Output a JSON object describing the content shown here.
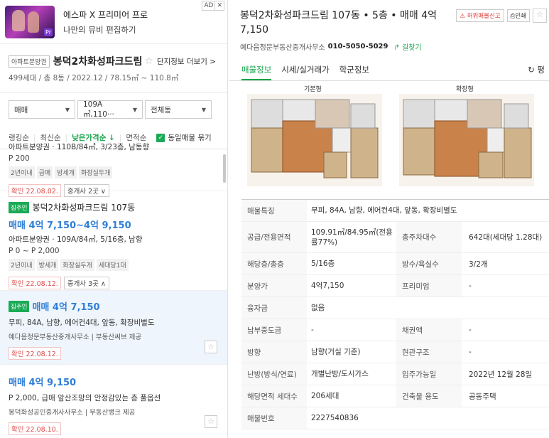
{
  "ad": {
    "title": "에스파 X 프리미어 프로",
    "subtitle": "나만의 뮤비 편집하기",
    "badge": "AD",
    "close": "✕",
    "thumb_badge": "Pr"
  },
  "complex": {
    "tag": "아파트분양권",
    "name": "봉덕2차화성파크드림",
    "more": "단지정보 더보기 >",
    "meta": "499세대 / 총 8동 / 2022.12 / 78.15㎡ ~ 110.8㎡"
  },
  "filters": {
    "trade": "매매",
    "area": "109A㎡,110···",
    "dong": "전체동"
  },
  "sort": {
    "ranking": "랭킹순",
    "latest": "최신순",
    "low_price": "낮은가격순 ↓",
    "area": "면적순",
    "group_label": "동일매물 묶기"
  },
  "listings": [
    {
      "desc": "아파트분양권 · 110B/84㎡, 3/23층, 남동향",
      "desc2": "P 200",
      "tags": [
        "2년이내",
        "급매",
        "방세개",
        "화장실두개"
      ],
      "confirmed": "확인 22.08.02.",
      "brokers": "중개사 2곳 ∨"
    },
    {
      "badge": "집주인",
      "title": "봉덕2차화성파크드림 107동",
      "price": "매매 4억 7,150~4억 9,150",
      "desc": "아파트분양권 · 109A/84㎡, 5/16층, 남향",
      "desc2": "P 0 ~ P 2,000",
      "tags": [
        "2년이내",
        "방세개",
        "화장실두개",
        "세대당1대"
      ],
      "confirmed": "확인 22.08.12.",
      "brokers": "중개사 3곳 ∧"
    },
    {
      "badge": "집주인",
      "price": "매매 4억 7,150",
      "desc": "무피, 84A, 남향, 에어컨4대, 앞동, 확장비별도",
      "agent": "예다음정문부동산중개사무소 | 부동산써브 제공",
      "confirmed": "확인 22.08.12."
    },
    {
      "price": "매매 4억 9,150",
      "desc": "P 2,000, 급매 앞산조망의 안정감있는 층 풀옵션",
      "agent": "봉덕화성공인중개사사무소 | 부동산뱅크 제공",
      "confirmed": "확인 22.08.10."
    }
  ],
  "detail": {
    "title": "봉덕2차화성파크드림 107동 • 5층 • 매매 4억 7,150",
    "report": "허위매물신고",
    "print": "인쇄",
    "agent": "예다음정문부동산중개사무소",
    "tel": "010-5050-5029",
    "directions": "길찾기",
    "tabs": [
      "매물정보",
      "시세/실거래가",
      "학군정보"
    ],
    "refresh": "평",
    "plan_labels": [
      "기본형",
      "확장형"
    ],
    "rows": [
      {
        "k": "매물특징",
        "v": "무피, 84A, 남향, 에어컨4대, 앞동, 확장비별도"
      },
      {
        "k": "공급/전용면적",
        "v": "109.91㎡/84.95㎡(전용률77%)",
        "k2": "총주차대수",
        "v2": "642대(세대당 1.28대)"
      },
      {
        "k": "해당층/총층",
        "v": "5/16층",
        "k2": "방수/욕실수",
        "v2": "3/2개"
      },
      {
        "k": "분양가",
        "v": "4억7,150",
        "k2": "프리미엄",
        "v2": "-"
      },
      {
        "k": "융자금",
        "v": "없음"
      },
      {
        "k": "납부중도금",
        "v": "-",
        "k2": "채권액",
        "v2": "-"
      },
      {
        "k": "방향",
        "v": "남향(거실 기준)",
        "k2": "현관구조",
        "v2": "-"
      },
      {
        "k": "난방(방식/연료)",
        "v": "개별난방/도시가스",
        "k2": "입주가능일",
        "v2": "2022년 12월 28일"
      },
      {
        "k": "해당면적 세대수",
        "v": "206세대",
        "k2": "건축물 용도",
        "v2": "공동주택"
      },
      {
        "k": "매물번호",
        "v": "2227540836"
      }
    ]
  }
}
